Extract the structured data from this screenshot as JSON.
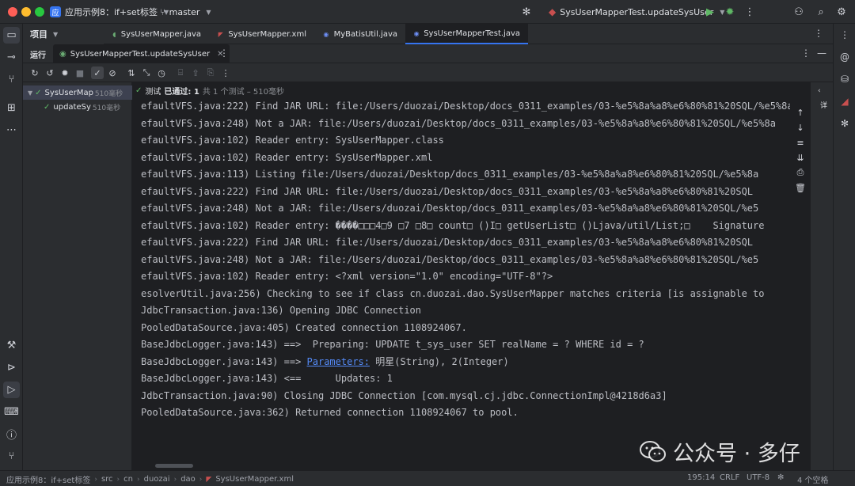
{
  "titlebar": {
    "project_badge": "应",
    "project_name": "应用示例8：if+set标签",
    "branch": "master",
    "run_config": "SysUserMapperTest.updateSysUser",
    "icons": [
      "debug-bug-icon",
      "run-icon",
      "debug-icon",
      "more-icon",
      "add-user-icon",
      "search-icon",
      "settings-icon"
    ]
  },
  "project_panel": {
    "label": "项目"
  },
  "editor_tabs": [
    {
      "label": "SysUserMapper.java",
      "icon": "java-interface-icon"
    },
    {
      "label": "SysUserMapper.xml",
      "icon": "xml-icon"
    },
    {
      "label": "MyBatisUtil.java",
      "icon": "java-class-icon"
    },
    {
      "label": "SysUserMapperTest.java",
      "icon": "java-test-icon",
      "active": true
    }
  ],
  "run_panel": {
    "label": "运行",
    "tab_label": "SysUserMapperTest.updateSysUser",
    "test_status": {
      "prefix": "测试",
      "passed": "已通过: 1",
      "detail": "共 1 个测试 – 510毫秒"
    },
    "tree": [
      {
        "label": "SysUserMap",
        "time": "510毫秒",
        "selected": true
      },
      {
        "label": "updateSy",
        "time": "510毫秒"
      }
    ],
    "side_label": "详"
  },
  "console_lines": [
    "efaultVFS.java:222) Find JAR URL: file:/Users/duozai/Desktop/docs_0311_examples/03-%e5%8a%a8%e6%80%81%20SQL/%e5%8a",
    "efaultVFS.java:248) Not a JAR: file:/Users/duozai/Desktop/docs_0311_examples/03-%e5%8a%a8%e6%80%81%20SQL/%e5%8a",
    "efaultVFS.java:102) Reader entry: SysUserMapper.class",
    "efaultVFS.java:102) Reader entry: SysUserMapper.xml",
    "efaultVFS.java:113) Listing file:/Users/duozai/Desktop/docs_0311_examples/03-%e5%8a%a8%e6%80%81%20SQL/%e5%8a",
    "efaultVFS.java:222) Find JAR URL: file:/Users/duozai/Desktop/docs_0311_examples/03-%e5%8a%a8%e6%80%81%20SQL",
    "efaultVFS.java:248) Not a JAR: file:/Users/duozai/Desktop/docs_0311_examples/03-%e5%8a%a8%e6%80%81%20SQL/%e5",
    "efaultVFS.java:102) Reader entry: ����□□□4□9 □7 □8□ count□ ()I□ getUserList□ ()Ljava/util/List;□    Signature",
    "efaultVFS.java:222) Find JAR URL: file:/Users/duozai/Desktop/docs_0311_examples/03-%e5%8a%a8%e6%80%81%20SQL",
    "efaultVFS.java:248) Not a JAR: file:/Users/duozai/Desktop/docs_0311_examples/03-%e5%8a%a8%e6%80%81%20SQL/%e5",
    "efaultVFS.java:102) Reader entry: <?xml version=\"1.0\" encoding=\"UTF-8\"?>",
    "esolverUtil.java:256) Checking to see if class cn.duozai.dao.SysUserMapper matches criteria [is assignable to",
    "JdbcTransaction.java:136) Opening JDBC Connection",
    "PooledDataSource.java:405) Created connection 1108924067.",
    "BaseJdbcLogger.java:143) ==>  Preparing: UPDATE t_sys_user SET realName = ? WHERE id = ?",
    "BaseJdbcLogger.java:143) ==> ",
    "BaseJdbcLogger.java:143) <==      Updates: 1",
    "JdbcTransaction.java:90) Closing JDBC Connection [com.mysql.cj.jdbc.ConnectionImpl@4218d6a3]",
    "PooledDataSource.java:362) Returned connection 1108924067 to pool."
  ],
  "params_line": {
    "link": "Parameters:",
    "rest": " 明星(String), 2(Integer)"
  },
  "statusbar": {
    "crumbs": [
      "应用示例8：if+set标签",
      "src",
      "cn",
      "duozai",
      "dao",
      "SysUserMapper.xml"
    ],
    "position": "195:14",
    "line_ending": "CRLF",
    "encoding": "UTF-8",
    "indent": "4 个空格"
  },
  "watermark": {
    "text": "公众号 · 多仔"
  }
}
